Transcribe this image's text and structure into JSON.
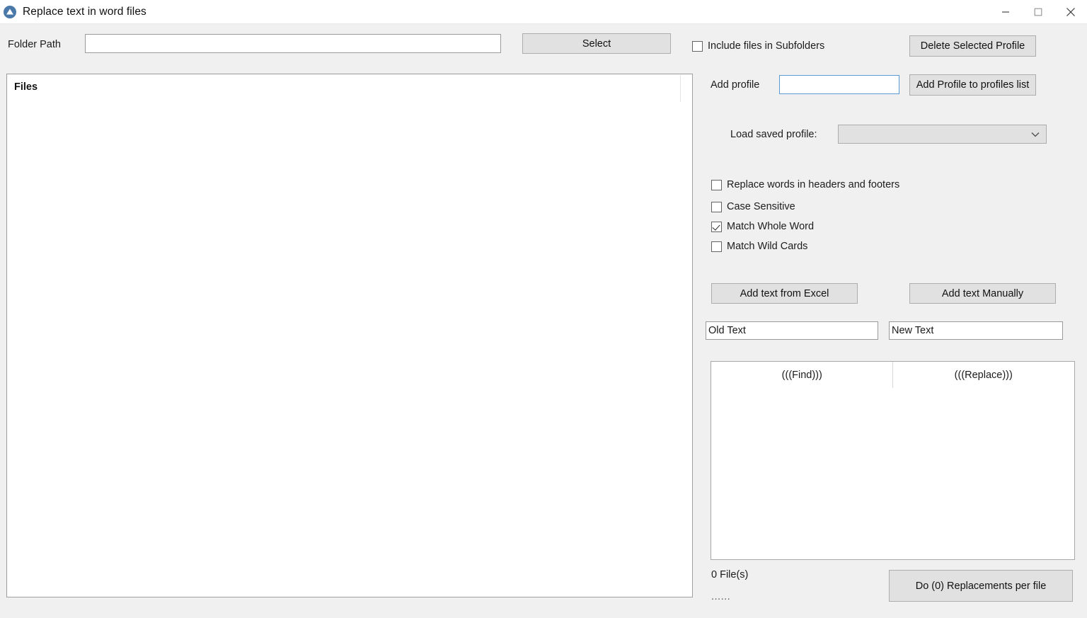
{
  "window": {
    "title": "Replace text in word files",
    "icon": "app-logo-icon",
    "controls": {
      "minimize": "minimize-icon",
      "maximize": "maximize-icon",
      "close": "close-icon"
    }
  },
  "toolbar": {
    "folder_path_label": "Folder Path",
    "folder_path_value": "",
    "folder_path_placeholder": "",
    "select_button": "Select",
    "include_subfolders_label": "Include files in Subfolders",
    "include_subfolders_checked": false,
    "delete_selected_profile_button": "Delete Selected Profile"
  },
  "profile": {
    "add_profile_label": "Add profile",
    "add_profile_value": "",
    "add_profile_placeholder": "",
    "add_profile_button": "Add Profile to profiles list",
    "load_saved_profile_label": "Load saved profile:",
    "load_saved_profile_selected": "",
    "load_saved_profile_options": []
  },
  "options": [
    {
      "label": "Replace words in headers and footers",
      "checked": false
    },
    {
      "label": "Case Sensitive",
      "checked": false
    },
    {
      "label": "Match Whole Word",
      "checked": true
    },
    {
      "label": "Match Wild Cards",
      "checked": false
    }
  ],
  "actions": {
    "add_text_from_excel": "Add text from Excel",
    "add_text_manually": "Add text Manually"
  },
  "text_fields": {
    "old_text_value": "Old Text",
    "new_text_value": "New Text"
  },
  "grid": {
    "columns": [
      "(((Find)))",
      "(((Replace)))"
    ],
    "rows": []
  },
  "files_panel": {
    "header": "Files",
    "items": []
  },
  "status": {
    "file_count_text": "0 File(s)",
    "progress_text": "......",
    "do_replacements_button": "Do (0) Replacements per file"
  },
  "colors": {
    "window_background": "#f0f0f0",
    "titlebar_background": "#ffffff",
    "button_face": "#e1e1e1",
    "button_border": "#adadad",
    "input_background": "#ffffff",
    "input_border": "#9a9a9a",
    "focus_border": "#5b9bd5",
    "accent_icon": "#4a78a8",
    "text": "#1a1a1a"
  }
}
